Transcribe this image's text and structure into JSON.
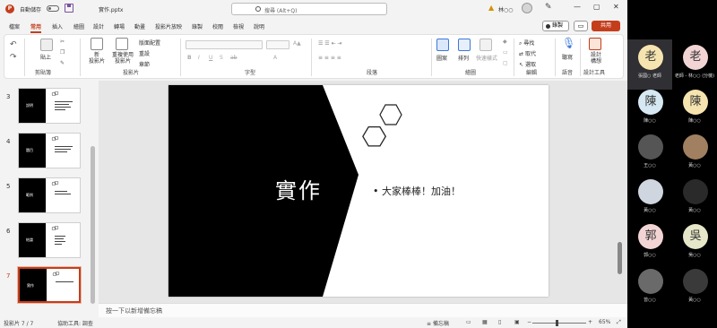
{
  "titlebar": {
    "autosave_label": "自動儲存",
    "doc_title": "實作.pptx",
    "search_placeholder": "搜尋 (Alt+Q)",
    "warning_icon": "warning-icon",
    "user_name": "林○○",
    "minimize": "—",
    "maximize": "▢",
    "close": "✕"
  },
  "tabs": [
    "檔案",
    "常用",
    "插入",
    "繪圖",
    "設計",
    "轉場",
    "動畫",
    "投影片放映",
    "錄製",
    "校閱",
    "檢視",
    "說明"
  ],
  "active_tab": "常用",
  "header_buttons": {
    "record": "錄製",
    "comment": "▭",
    "share": "共用"
  },
  "ribbon": {
    "groups": [
      "剪貼簿",
      "投影片",
      "字型",
      "段落",
      "繪圖",
      "編輯",
      "語音",
      "設計工具"
    ],
    "paste": "貼上",
    "new_slide": "新\n投影片",
    "reuse_slide": "重複使用投影片",
    "layout": "版面配置",
    "reset": "重設",
    "section": "章節",
    "shapes": "圖案",
    "arrange": "排列",
    "quick_styles": "快速樣式",
    "find": "尋找",
    "replace": "取代",
    "select": "選取",
    "dictate": "聽寫",
    "designer": "設計\n構想"
  },
  "thumbnails": [
    {
      "num": "3",
      "label": "說明"
    },
    {
      "num": "4",
      "label": "題目"
    },
    {
      "num": "5",
      "label": "範例"
    },
    {
      "num": "6",
      "label": "結論"
    },
    {
      "num": "7",
      "label": "實作"
    }
  ],
  "active_slide": "7",
  "slide": {
    "title": "實作",
    "bullet": "大家棒棒！加油！"
  },
  "notes_placeholder": "按一下以新增備忘稿",
  "status": {
    "slide_count": "投影片 7 / 7",
    "accessibility": "協助工具: 調查",
    "notes": "備忘稿",
    "zoom": "65%"
  },
  "participants": [
    {
      "initial": "老",
      "name": "張國○ 老師",
      "color": "#f6e4b0",
      "active": true
    },
    {
      "initial": "老",
      "name": "老師 - 林○○ (分機)",
      "color": "#f3d4d4",
      "active": false
    },
    {
      "initial": "陳",
      "name": "陳○○",
      "color": "#d6e8f2",
      "active": false
    },
    {
      "initial": "陳",
      "name": "陳○○",
      "color": "#f6e4b0",
      "active": false
    },
    {
      "initial": "",
      "name": "王○○",
      "color": "#555555",
      "active": false
    },
    {
      "initial": "",
      "name": "黃○○",
      "color": "#a08060",
      "active": false
    },
    {
      "initial": "",
      "name": "黃○○",
      "color": "#cfd6e0",
      "active": false
    },
    {
      "initial": "",
      "name": "黃○○",
      "color": "#2a2a2a",
      "active": false
    },
    {
      "initial": "郭",
      "name": "郭○○",
      "color": "#f3d4d4",
      "active": false
    },
    {
      "initial": "吳",
      "name": "吳○○",
      "color": "#e6e6c8",
      "active": false
    },
    {
      "initial": "",
      "name": "曾○○",
      "color": "#6a6a6a",
      "active": false
    },
    {
      "initial": "",
      "name": "黃○○",
      "color": "#3a3a3a",
      "active": false
    }
  ],
  "colors": {
    "accent": "#c43e1c",
    "slide_dark": "#000000"
  }
}
